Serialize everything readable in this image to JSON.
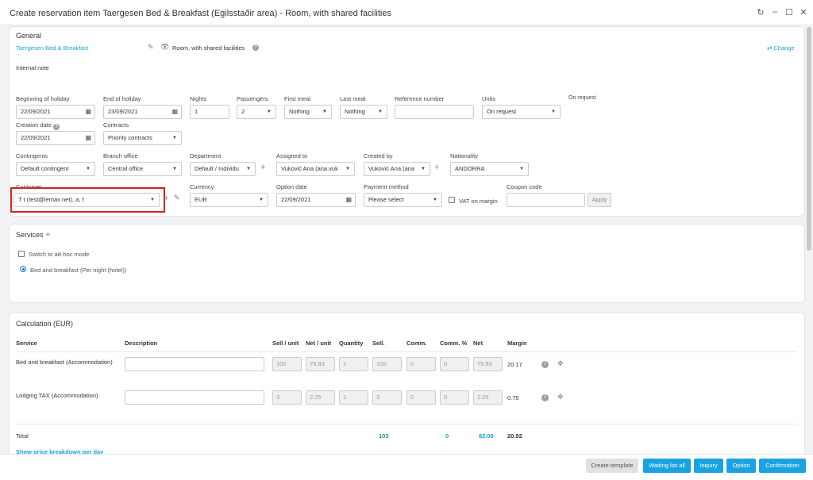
{
  "window": {
    "title": "Create reservation item Taergesen Bed & Breakfast (Egilsstaðir area) - Room, with shared facilities"
  },
  "general": {
    "title": "General",
    "property": "Taergesen Bed & Breakfast",
    "room": "Room, with shared facilities",
    "change": "Change",
    "internal_note": "Internal note",
    "beginning_label": "Beginning of holiday",
    "beginning_value": "22/09/2021",
    "end_label": "End of holiday",
    "end_value": "23/09/2021",
    "nights_label": "Nights",
    "nights_value": "1",
    "passengers_label": "Passengers",
    "passengers_value": "2",
    "first_meal_label": "First meal",
    "first_meal_value": "Nothing",
    "last_meal_label": "Last meal",
    "last_meal_value": "Nothing",
    "reference_label": "Reference number",
    "reference_value": "",
    "units_label": "Units",
    "units_value": "On request",
    "on_request": "On request",
    "creation_label": "Creation date",
    "creation_value": "22/09/2021",
    "contracts_label": "Contracts",
    "contracts_value": "Priority contracts",
    "contingents_label": "Contingents",
    "contingents_value": "Default contingent",
    "branch_label": "Branch office",
    "branch_value": "Central office",
    "department_label": "Department",
    "department_value": "Default / Individu",
    "assigned_label": "Assigned to",
    "assigned_value": "Vuković Ana (ana.vuk",
    "created_by_label": "Created by",
    "created_by_value": "Vuković Ana (ana",
    "nationality_label": "Nationality",
    "nationality_value": "ANDORRA",
    "customer_label": "Customer",
    "customer_value": "T t (test@lemax.net), a, f",
    "currency_label": "Currency",
    "currency_value": "EUR",
    "option_date_label": "Option date",
    "option_date_value": "22/09/2021",
    "payment_label": "Payment method",
    "payment_value": "Please select",
    "vat_label": "VAT on margin",
    "coupon_label": "Coupon code",
    "coupon_value": "",
    "apply": "Apply"
  },
  "services": {
    "title": "Services",
    "adhoc": "Switch to ad-hoc mode",
    "option": "Bed and breakfast (Per night (hotel))"
  },
  "calculation": {
    "title": "Calculation  (EUR)",
    "headers": {
      "service": "Service",
      "description": "Description",
      "sell_unit": "Sell / unit",
      "net_unit": "Net / unit",
      "quantity": "Quantity",
      "sell": "Sell.",
      "comm": "Comm.",
      "comm_pct": "Comm. %",
      "net": "Net",
      "margin": "Margin"
    },
    "rows": [
      {
        "service": "Bed and breakfast (Accommodation)",
        "sell_unit": "100",
        "net_unit": "79.83",
        "quantity": "1",
        "sell": "100",
        "comm": "0",
        "comm_pct": "0",
        "net": "79.83",
        "margin": "20.17"
      },
      {
        "service": "Lodging TAX (Accommodation)",
        "sell_unit": "3",
        "net_unit": "2.25",
        "quantity": "1",
        "sell": "3",
        "comm": "0",
        "comm_pct": "0",
        "net": "2.25",
        "margin": "0.75"
      }
    ],
    "total_label": "Total",
    "total_sell": "103",
    "total_comm": "0",
    "total_net": "82.08",
    "total_margin": "20.92",
    "breakdown_link": "Show price breakdown per day"
  },
  "footer": {
    "create_template": "Create template",
    "waiting_list": "Waiting list all",
    "inquiry": "Inquiry",
    "option": "Option",
    "confirmation": "Confirmation"
  }
}
